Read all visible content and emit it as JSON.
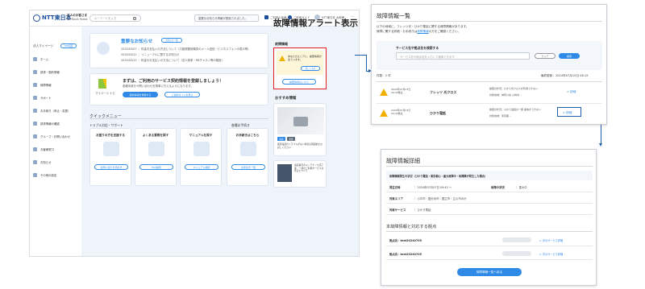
{
  "header": {
    "logo_text": "NTT東日本",
    "biz_title": "法人のお客さま",
    "biz_sub": "Biz Bank Portal",
    "search_placeholder": "キーワードを入力",
    "notice_bar": "重要なお知らせ情報が更新されました。",
    "cart_label": "ご利用の皆様",
    "guide_label": "ご利用ガイド",
    "user_label": "NTT東日本 太郎様"
  },
  "sidebar": {
    "mypage": "法人マイページ",
    "mypage_badge": "TOP画面",
    "items": [
      "ホーム",
      "請求・契約情報",
      "故障情報",
      "サポート",
      "お手続き（申込・変更）",
      "請求情報の確認",
      "グループ・お問い合わせ",
      "お客様窓口",
      "お知らせ",
      "その他の設定"
    ]
  },
  "notice": {
    "title": "重要なお知らせ",
    "badge": "お知らせ一覧",
    "lines": [
      "2025/03/07 ｜ 料金お支払いの方法について（口座振替依頼書のメール送信・ビジネスフォンの表示等）",
      "2025/03/22 ｜ リニューアルに関するお知らせ",
      "2025/03/22 ｜ 料金のお支払いの方法について（法人請求・RBチャネン等の取扱）"
    ]
  },
  "register": {
    "title": "まずは、ご利用のサービス契約情報を登録しましょう！",
    "desc": "各種手続きや問い合わせを簡単に行えるようになります。",
    "mark_label": "マイページ ナビ",
    "btn_primary": "契約情報を登録する",
    "btn_secondary": "ご契約ガイドを見る"
  },
  "quick": {
    "title": "クイックメニュー",
    "sub_left": "トラブル対応・サポート",
    "sub_right": "各種お手続き",
    "items": [
      {
        "title": "お困りの方を支援する",
        "btn": "お問い合わせ手続き"
      },
      {
        "title": "よくある質問を探す",
        "btn": "FAQ検索"
      },
      {
        "title": "マニュアルを探す",
        "btn": "マニュアル検索"
      },
      {
        "title": "お手続きはこちら",
        "btn": "お手続き一覧"
      }
    ]
  },
  "fault_widget": {
    "annotation": "故障情報アラート表示",
    "heading": "故障情報",
    "alert_text": "あなたのエリアに、故障情報が出ています。",
    "alert_link": "詳しくみる",
    "btn": "故障情報はこちら"
  },
  "recommend": {
    "heading": "おすすめ情報",
    "caption1": "固定電話のトラブルがない場合は再起動をお試しください",
    "tag1": "新着",
    "tag2": "重要",
    "caption2": "電話番号のメンテナンス完了後、一部のご利用サービスの停止について"
  },
  "fault_list": {
    "title": "故障情報一覧",
    "intro1": "以下の地域に、フレッツ光・ひかり電話に関する故障情報があります。",
    "intro2_pre": "故障に関する詳細・お手続きは",
    "intro2_link": "故障情報",
    "intro2_post": "の方をご確認ください。",
    "search_label": "サービス名や拠点名を検索する",
    "search_placeholder": "サービス名や拠点名を入力して検索できます",
    "clear_btn": "クリア",
    "search_btn": "検索",
    "count": "件数：2 件",
    "updated": "最終更新：2024年07月15日 06:15",
    "rows": [
      {
        "date": "2024年07月07日 09:43発生",
        "service": "フレッツ 光クロス",
        "detail1": "故障の状況：ひかり光クロスが利用できない",
        "detail2": "対象地域：神奈川県 川崎市…",
        "link": "詳細"
      },
      {
        "date": "2024年07月07日 09:43発生",
        "service": "ひかり電話",
        "detail1": "故障の状況：ひかり電話の一部 着信ができない",
        "detail2": "対象地域：東京都…",
        "link": "詳細"
      }
    ]
  },
  "fault_detail": {
    "title": "故障情報詳細",
    "subtitle": "故障情報発生の状況（ひかり電話・東京都心・重大故障中・故障障が発生した場合）",
    "occurred_label": "発生日時",
    "occurred_value": "2024年07月07日 09:43 〜",
    "status_label": "故障の状況",
    "status_value": "重大中",
    "area_label": "対象エリア",
    "area_value": "小平市・国分寺市・国立市・立川市ほか",
    "service_label": "対象サービス",
    "service_value": "ひかり電話",
    "sites_title": "本故障情報と対応する拠点",
    "sites": [
      {
        "name": "拠点名：test20240705",
        "link": "次のサービス詳細"
      },
      {
        "name": "拠点名：test20240705",
        "link": "次のサービス詳細"
      }
    ],
    "back_btn": "故障情報一覧へ戻る"
  },
  "colors": {
    "primary": "#2e8ae6",
    "alert_red": "#e02020",
    "warn": "#f0b000",
    "connector": "#1f5fa8"
  }
}
